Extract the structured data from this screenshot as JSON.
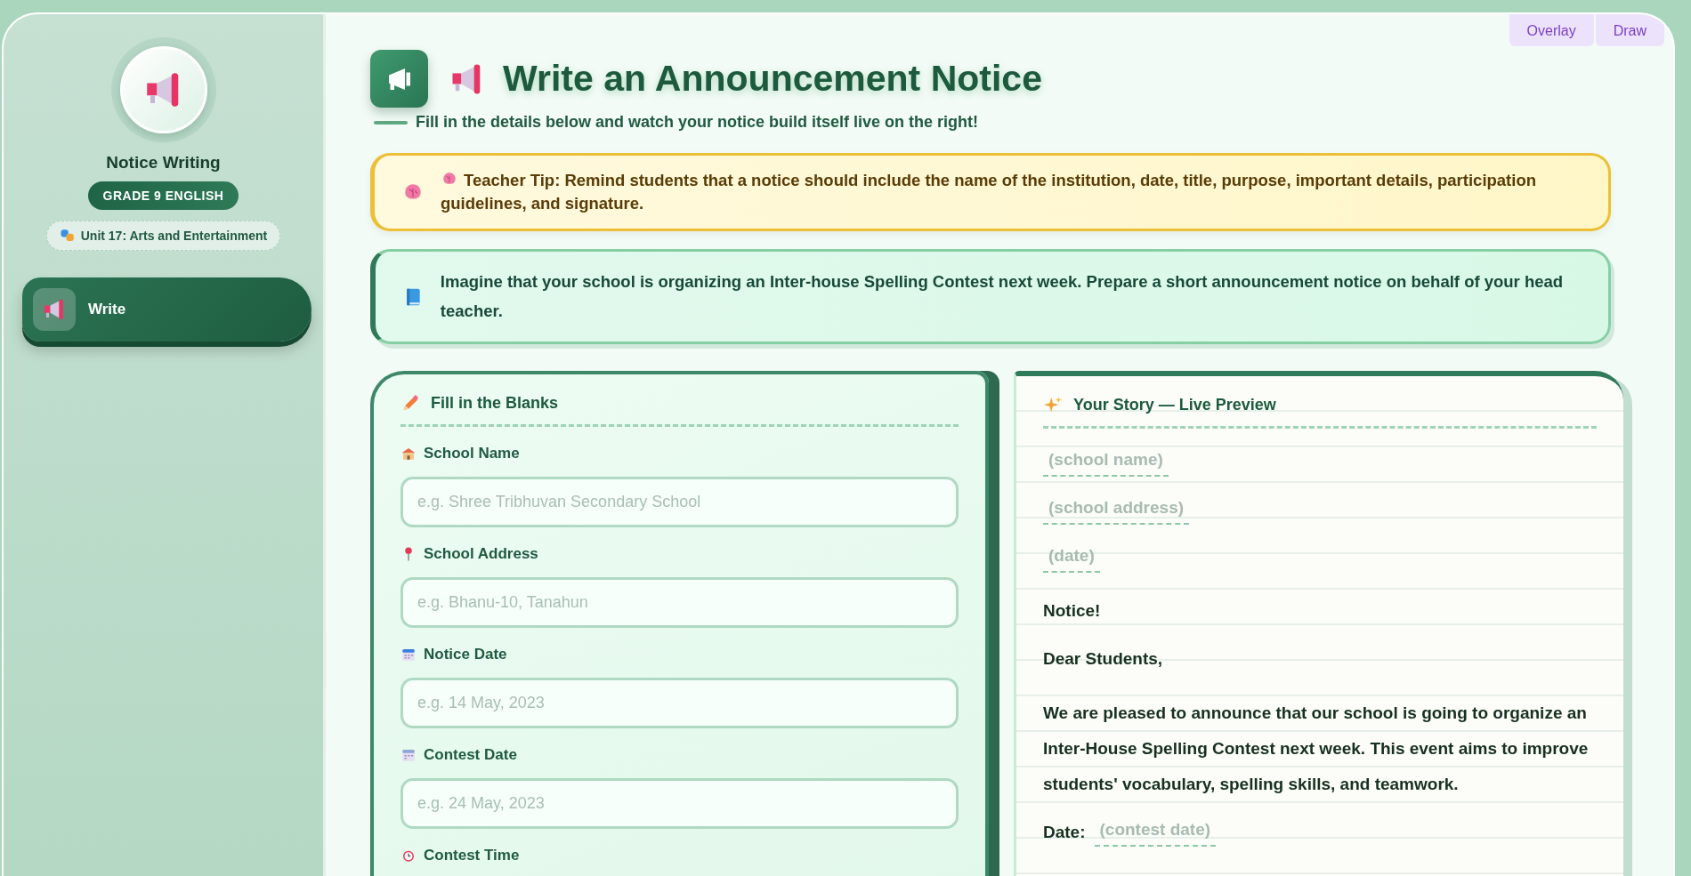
{
  "toolbar_buttons": [
    {
      "label": "Overlay"
    },
    {
      "label": "Draw"
    }
  ],
  "sidebar": {
    "title": "Notice Writing",
    "grade_badge": "GRADE 9 ENGLISH",
    "unit": "Unit 17: Arts and Entertainment",
    "nav_items": [
      {
        "label": "Write",
        "selected": true
      }
    ]
  },
  "header": {
    "title": "Write an Announcement Notice",
    "subtitle": "Fill in the details below and watch your notice build itself live on the right!"
  },
  "tip": {
    "text": "Teacher Tip: Remind students that a notice should include the name of the institution, date, title, purpose, important details, participation guidelines, and signature."
  },
  "task": {
    "text": "Imagine that your school is organizing an Inter-house Spelling Contest next week. Prepare a short announcement notice on behalf of your head teacher."
  },
  "form": {
    "title": "Fill in the Blanks",
    "fields": [
      {
        "label": "School Name",
        "placeholder": "e.g. Shree Tribhuvan Secondary School"
      },
      {
        "label": "School Address",
        "placeholder": "e.g. Bhanu-10, Tanahun"
      },
      {
        "label": "Notice Date",
        "placeholder": "e.g. 14 May, 2023"
      },
      {
        "label": "Contest Date",
        "placeholder": "e.g. 24 May, 2023"
      },
      {
        "label": "Contest Time"
      }
    ]
  },
  "preview": {
    "title": "Your Story — Live Preview",
    "lines": [
      {
        "kind": "blank",
        "text": "(school name)"
      },
      {
        "kind": "blank",
        "text": "(school address)"
      },
      {
        "kind": "blank",
        "text": "(date)"
      },
      {
        "kind": "text",
        "text": "Notice!"
      },
      {
        "kind": "text",
        "text": "Dear Students,"
      },
      {
        "kind": "paragraph",
        "text": "We are pleased to announce that our school is going to organize an Inter-House Spelling Contest next week. This event aims to improve students' vocabulary, spelling skills, and teamwork."
      },
      {
        "kind": "field",
        "label": "Date:",
        "blank": "(contest date)"
      }
    ]
  }
}
